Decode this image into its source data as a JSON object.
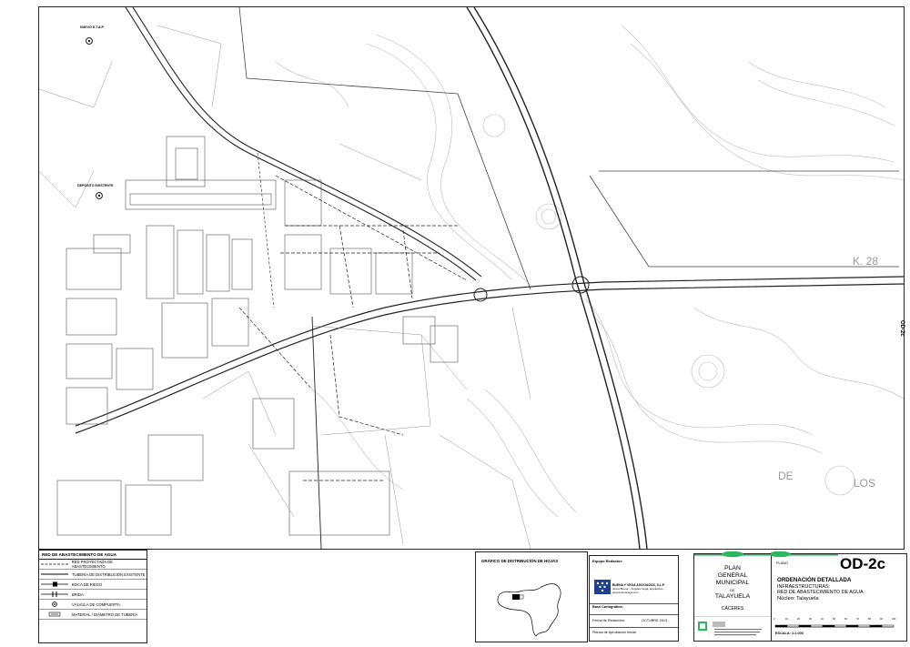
{
  "sheet_code": "OD-2c",
  "side_code": "OD-2c",
  "plan_label": "PLANO",
  "title": {
    "line1": "ORDENACIÓN DETALLADA",
    "line2": "INFRAESTRUCTURAS:",
    "line3": "RED DE ABASTECIMIENTO DE AGUA",
    "line4": "Núcleo: Talayuela"
  },
  "plan_general": {
    "l1": "PLAN",
    "l2": "GENERAL",
    "l3": "MUNICIPAL",
    "l4": "DE",
    "l5": "TALAYUELA",
    "province": "CÁCERES"
  },
  "scale_label": "ESCALA:  1:2.000",
  "scale_ticks": [
    "0",
    "10",
    "20",
    "30",
    "40",
    "50",
    "60",
    "70",
    "80",
    "90",
    "100"
  ],
  "distribution": {
    "title": "GRÁFICO DE DISTRIBUCIÓN DE HOJAS"
  },
  "team": {
    "label": "Equipo Redactor:",
    "company": "BUENA Y VEGA ASOCIADOS, S.L.P.",
    "address": "Jesús Buena – Ángeles Vega, arquitectos",
    "web": "www.buenavega.com",
    "base_label": "Base Cartográfica:",
    "date_label": "Fecha de Redacción:",
    "date_value": "OCTUBRE 2013",
    "stage_label": "Planos de Aprobación Inicial"
  },
  "legend": {
    "title": "RED DE ABASTECIMIENTO DE AGUA",
    "items": [
      {
        "symbol": "dashed-line",
        "label": "RED PROYECTADA DE ABASTECIMIENTO"
      },
      {
        "symbol": "solid-line",
        "label": "TUBERÍA DE DISTRIBUCIÓN EXISTENTE"
      },
      {
        "symbol": "hydrant-line",
        "label": "BOCA DE RIEGO"
      },
      {
        "symbol": "flange-line",
        "label": "BRIDA"
      },
      {
        "symbol": "valve-circle",
        "label": "VÁLVULA DE COMPUERTA"
      },
      {
        "symbol": "material-tag",
        "label": "MATERIAL / DIÁMETRO DE TUBERÍA"
      }
    ]
  },
  "map_labels": {
    "road_km": "K. 28",
    "road_de": "DE",
    "road_los": "LOS",
    "deposit_new": "NUEVO E.T.A.P.",
    "deposit_existing": "DEPÓSITO EXISTENTE"
  },
  "colors": {
    "line": "#222222",
    "contour": "#b8b8b8",
    "parcel": "#6e6e6e",
    "green": "#2db85b",
    "logo_blue": "#1f3f8f"
  }
}
